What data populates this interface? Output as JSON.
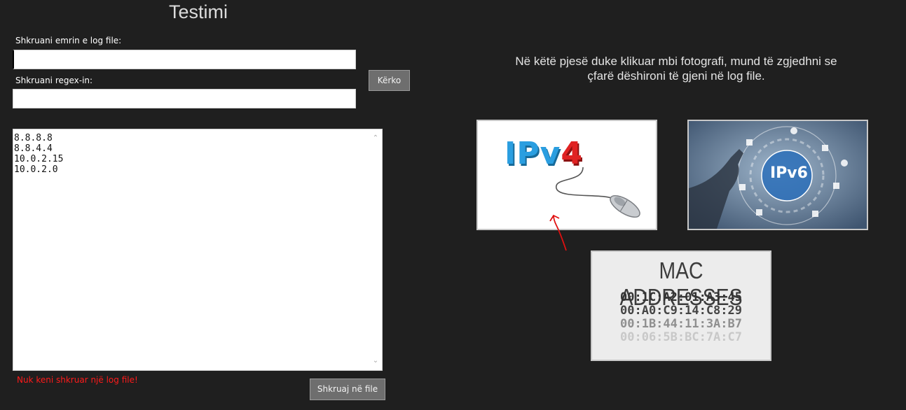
{
  "header": {
    "title": "Testimi"
  },
  "form": {
    "logfile_label": "Shkruani emrin e log file:",
    "logfile_value": "",
    "regex_label": "Shkruani regex-in:",
    "regex_value": "",
    "search_button": "Kërko"
  },
  "results": {
    "lines": [
      "8.8.8.8",
      "8.8.4.4",
      "10.0.2.15",
      "10.0.2.0"
    ]
  },
  "error_message": "Nuk keni shkruar një log file!",
  "write_button": "Shkruaj në file",
  "info": {
    "description": "Në këtë pjesë duke klikuar mbi fotografi, mund të zgjedhni se çfarë dëshironi të gjeni në log file."
  },
  "tiles": {
    "ipv4": {
      "word_main": "IPv",
      "word_num": "4",
      "icon": "mouse-cable-icon"
    },
    "ipv6": {
      "word": "IPv6",
      "icon": "touch-hand-icon"
    },
    "mac": {
      "title": "MAC ADDRESSES",
      "addresses": [
        "00:1C:A2:01:A3:45",
        "00:A0:C9:14:C8:29",
        "00:1B:44:11:3A:B7",
        "00:06:5B:BC:7A:C7"
      ]
    }
  },
  "colors": {
    "background": "#1f1f1f",
    "error": "#ff1a1a",
    "button": "#6e6e6e",
    "annotation": "#e01010"
  }
}
